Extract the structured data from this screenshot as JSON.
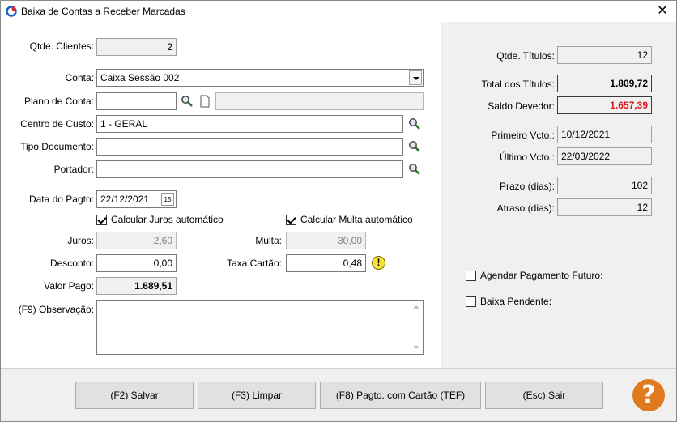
{
  "window": {
    "title": "Baixa de Contas a Receber Marcadas",
    "close_glyph": "✕"
  },
  "left": {
    "qtde_clientes": {
      "label": "Qtde. Clientes:",
      "value": "2"
    },
    "conta": {
      "label": "Conta:",
      "value": "Caixa Sessão 002"
    },
    "plano_conta": {
      "label": "Plano de Conta:",
      "value": "",
      "desc": ""
    },
    "centro_custo": {
      "label": "Centro de Custo:",
      "value": "1 - GERAL"
    },
    "tipo_documento": {
      "label": "Tipo Documento:",
      "value": ""
    },
    "portador": {
      "label": "Portador:",
      "value": ""
    },
    "data_pagto": {
      "label": "Data do Pagto:",
      "value": "22/12/2021",
      "cal_label": "15"
    },
    "calc_juros": {
      "label": "Calcular Juros automático",
      "checked": true
    },
    "calc_multa": {
      "label": "Calcular Multa automático",
      "checked": true
    },
    "juros": {
      "label": "Juros:",
      "value": "2,60"
    },
    "multa": {
      "label": "Multa:",
      "value": "30,00"
    },
    "desconto": {
      "label": "Desconto:",
      "value": "0,00"
    },
    "taxa_cartao": {
      "label": "Taxa Cartão:",
      "value": "0,48",
      "warning_glyph": "!"
    },
    "valor_pago": {
      "label": "Valor Pago:",
      "value": "1.689,51"
    },
    "observacao": {
      "label": "(F9) Observação:",
      "value": ""
    }
  },
  "right": {
    "qtde_titulos": {
      "label": "Qtde. Títulos:",
      "value": "12"
    },
    "total_titulos": {
      "label": "Total dos Títulos:",
      "value": "1.809,72"
    },
    "saldo_devedor": {
      "label": "Saldo Devedor:",
      "value": "1.657,39"
    },
    "primeiro_vcto": {
      "label": "Primeiro Vcto.:",
      "value": "10/12/2021"
    },
    "ultimo_vcto": {
      "label": "Último Vcto.:",
      "value": "22/03/2022"
    },
    "prazo": {
      "label": "Prazo (dias):",
      "value": "102"
    },
    "atraso": {
      "label": "Atraso (dias):",
      "value": "12"
    },
    "agendar": {
      "label": "Agendar Pagamento Futuro:",
      "checked": false
    },
    "baixa_pendente": {
      "label": "Baixa Pendente:",
      "checked": false
    }
  },
  "footer": {
    "salvar": "(F2) Salvar",
    "limpar": "(F3) Limpar",
    "pagto_cartao": "(F8) Pagto. com Cartão (TEF)",
    "sair": "(Esc) Sair",
    "help_glyph": "?"
  },
  "colors": {
    "saldo_devedor": "#e0161b",
    "help": "#e07a1f",
    "panel_bg": "#f0f0f0"
  }
}
